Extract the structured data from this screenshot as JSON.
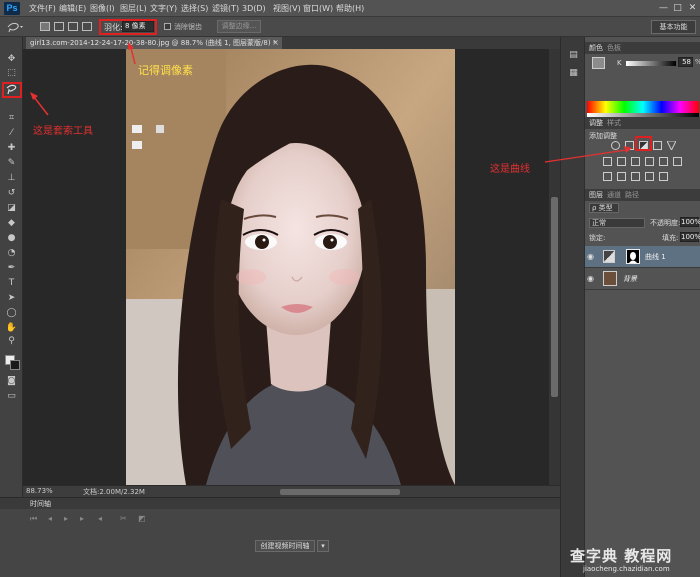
{
  "app": {
    "logo": "Ps"
  },
  "menu": [
    "文件(F)",
    "编辑(E)",
    "图像(I)",
    "图层(L)",
    "文字(Y)",
    "选择(S)",
    "滤镜(T)",
    "3D(D)",
    "视图(V)",
    "窗口(W)",
    "帮助(H)"
  ],
  "window_controls": {
    "minimize": "—",
    "restore": "□",
    "close": "✕"
  },
  "options": {
    "feather_label": "羽化:",
    "feather_value": "8 像素",
    "antialias_label": "消除锯齿",
    "refine_edge": "调整边缘...",
    "workspace": "基本功能"
  },
  "document": {
    "tab_title": "girl13.com-2014-12-24-17-20-38-80.jpg @ 88.7% (曲线 1, 图层蒙版/8) *",
    "tab_close": "×",
    "zoom": "88.73%",
    "doc_size": "文档:2.00M/2.32M"
  },
  "timeline": {
    "title": "时间轴",
    "create_button": "创建视频时间轴",
    "create_arrow": "▾"
  },
  "color_panel": {
    "tabs": [
      "颜色",
      "色板"
    ],
    "channel": "K",
    "value": "58",
    "unit": "%"
  },
  "adjustments_panel": {
    "tabs": [
      "调整",
      "样式"
    ],
    "add_label": "添加调整"
  },
  "layers_panel": {
    "tabs": [
      "图层",
      "通道",
      "路径"
    ],
    "filter": "ρ 类型",
    "blend_mode": "正常",
    "opacity_label": "不透明度:",
    "opacity_value": "100%",
    "lock_label": "锁定:",
    "fill_label": "填充:",
    "fill_value": "100%",
    "layers": [
      {
        "name": "曲线 1",
        "selected": true
      },
      {
        "name": "背景",
        "selected": false
      }
    ]
  },
  "annotations": {
    "lasso": "这是套索工具",
    "pixel": "记得调像素",
    "curves": "这是曲线"
  },
  "watermark": {
    "main": "查字典 教程网",
    "sub": "jiaocheng.chazidian.com"
  },
  "colors": {
    "annotation_red": "#e53030",
    "annotation_yellow": "#ffe24a",
    "selected_layer": "#5e7182"
  }
}
